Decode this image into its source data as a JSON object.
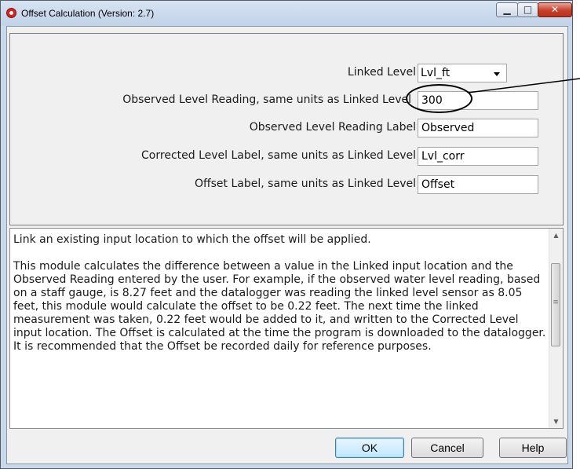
{
  "window": {
    "title": "Offset Calculation (Version: 2.7)",
    "min_glyph": "▁",
    "max_glyph": "□",
    "close_glyph": "✕"
  },
  "form": {
    "linked_level": {
      "label": "Linked Level",
      "value": "Lvl_ft"
    },
    "observed_reading": {
      "label": "Observed Level Reading, same units as Linked Level",
      "value": "300"
    },
    "observed_label": {
      "label": "Observed Level Reading Label",
      "value": "Observed"
    },
    "corrected_label": {
      "label": "Corrected Level Label, same units as Linked Level",
      "value": "Lvl_corr"
    },
    "offset_label": {
      "label": "Offset Label, same units as Linked Level",
      "value": "Offset"
    }
  },
  "help": {
    "text": "Link an existing input location to which the offset will be applied.\n\nThis module calculates the difference between a value in the Linked input location and the Observed Reading entered by the user. For example, if the observed water level reading, based on a staff gauge, is 8.27 feet and the datalogger was reading the linked level sensor as 8.05 feet, this module would calculate the offset to be 0.22 feet. The next time the linked measurement was taken, 0.22 feet would be added to it, and written to the Corrected Level input location.  The Offset is calculated at the time the program is downloaded to the datalogger. It is recommended that the Offset be recorded daily for reference purposes."
  },
  "buttons": {
    "ok": "OK",
    "cancel": "Cancel",
    "help": "Help"
  }
}
